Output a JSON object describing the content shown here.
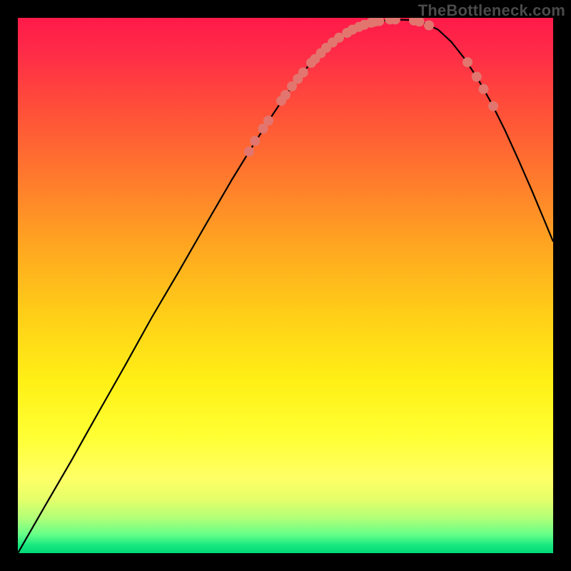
{
  "watermark": "TheBottleneck.com",
  "chart_data": {
    "type": "line",
    "title": "",
    "xlabel": "",
    "ylabel": "",
    "xlim": [
      0,
      1
    ],
    "ylim": [
      0,
      1
    ],
    "curve": [
      {
        "x": 0.0,
        "y": 0.0
      },
      {
        "x": 0.05,
        "y": 0.087
      },
      {
        "x": 0.1,
        "y": 0.173
      },
      {
        "x": 0.15,
        "y": 0.262
      },
      {
        "x": 0.2,
        "y": 0.35
      },
      {
        "x": 0.25,
        "y": 0.44
      },
      {
        "x": 0.3,
        "y": 0.525
      },
      {
        "x": 0.35,
        "y": 0.612
      },
      {
        "x": 0.4,
        "y": 0.698
      },
      {
        "x": 0.435,
        "y": 0.755
      },
      {
        "x": 0.47,
        "y": 0.81
      },
      {
        "x": 0.5,
        "y": 0.855
      },
      {
        "x": 0.53,
        "y": 0.895
      },
      {
        "x": 0.56,
        "y": 0.93
      },
      {
        "x": 0.59,
        "y": 0.955
      },
      {
        "x": 0.615,
        "y": 0.972
      },
      {
        "x": 0.64,
        "y": 0.984
      },
      {
        "x": 0.67,
        "y": 0.993
      },
      {
        "x": 0.7,
        "y": 0.997
      },
      {
        "x": 0.73,
        "y": 0.996
      },
      {
        "x": 0.76,
        "y": 0.99
      },
      {
        "x": 0.785,
        "y": 0.978
      },
      {
        "x": 0.81,
        "y": 0.955
      },
      {
        "x": 0.835,
        "y": 0.923
      },
      {
        "x": 0.86,
        "y": 0.885
      },
      {
        "x": 0.885,
        "y": 0.84
      },
      {
        "x": 0.91,
        "y": 0.79
      },
      {
        "x": 0.935,
        "y": 0.735
      },
      {
        "x": 0.96,
        "y": 0.678
      },
      {
        "x": 0.985,
        "y": 0.618
      },
      {
        "x": 1.0,
        "y": 0.582
      }
    ],
    "points": [
      {
        "x": 0.432,
        "y": 0.75
      },
      {
        "x": 0.443,
        "y": 0.77
      },
      {
        "x": 0.458,
        "y": 0.793
      },
      {
        "x": 0.468,
        "y": 0.808
      },
      {
        "x": 0.492,
        "y": 0.845
      },
      {
        "x": 0.5,
        "y": 0.856
      },
      {
        "x": 0.512,
        "y": 0.872
      },
      {
        "x": 0.523,
        "y": 0.886
      },
      {
        "x": 0.533,
        "y": 0.898
      },
      {
        "x": 0.548,
        "y": 0.916
      },
      {
        "x": 0.555,
        "y": 0.923
      },
      {
        "x": 0.566,
        "y": 0.934
      },
      {
        "x": 0.576,
        "y": 0.944
      },
      {
        "x": 0.588,
        "y": 0.954
      },
      {
        "x": 0.6,
        "y": 0.963
      },
      {
        "x": 0.615,
        "y": 0.972
      },
      {
        "x": 0.625,
        "y": 0.978
      },
      {
        "x": 0.637,
        "y": 0.983
      },
      {
        "x": 0.647,
        "y": 0.987
      },
      {
        "x": 0.66,
        "y": 0.991
      },
      {
        "x": 0.667,
        "y": 0.993
      },
      {
        "x": 0.675,
        "y": 0.994
      },
      {
        "x": 0.695,
        "y": 0.997
      },
      {
        "x": 0.705,
        "y": 0.997
      },
      {
        "x": 0.74,
        "y": 0.995
      },
      {
        "x": 0.75,
        "y": 0.993
      },
      {
        "x": 0.768,
        "y": 0.986
      },
      {
        "x": 0.84,
        "y": 0.917
      },
      {
        "x": 0.857,
        "y": 0.89
      },
      {
        "x": 0.87,
        "y": 0.867
      },
      {
        "x": 0.888,
        "y": 0.835
      }
    ],
    "point_color": "#e2766f",
    "curve_color": "#000000",
    "gradient_stops": [
      {
        "pos": 0.0,
        "color": "#ff1a49"
      },
      {
        "pos": 0.3,
        "color": "#ff7a2d"
      },
      {
        "pos": 0.55,
        "color": "#ffcd18"
      },
      {
        "pos": 0.78,
        "color": "#ffff33"
      },
      {
        "pos": 0.94,
        "color": "#b0ff78"
      },
      {
        "pos": 1.0,
        "color": "#00d877"
      }
    ]
  }
}
